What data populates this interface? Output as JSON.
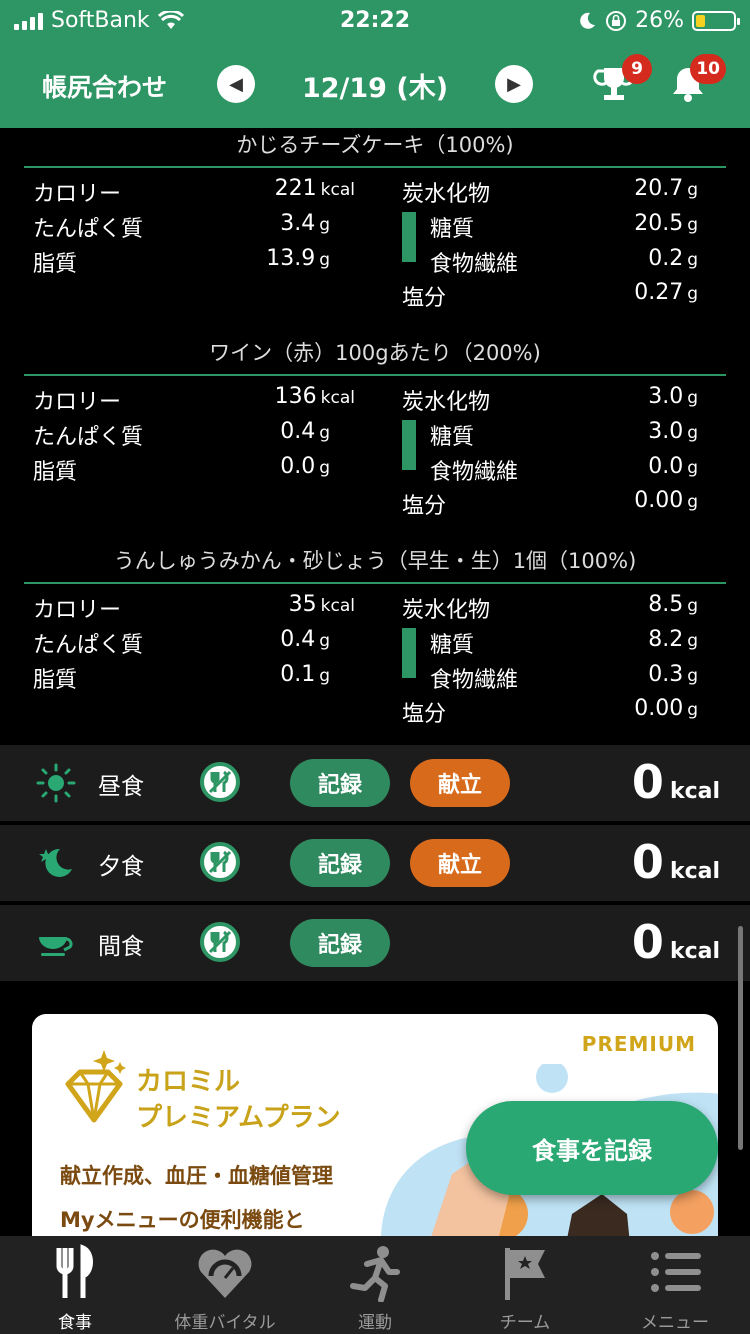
{
  "status_bar": {
    "carrier": "SoftBank",
    "time": "22:22",
    "battery": "26%",
    "battery_level": 0.26
  },
  "header": {
    "title": "帳尻合わせ",
    "date": "12/19 (木)",
    "trophy_badge": "9",
    "bell_badge": "10",
    "prev_icon": "chevron-left-icon",
    "next_icon": "chevron-right-icon"
  },
  "foods": [
    {
      "title": "かじるチーズケーキ（100%)",
      "calories_label": "カロリー",
      "calories": "221",
      "calories_unit": "kcal",
      "protein_label": "たんぱく質",
      "protein": "3.4",
      "protein_unit": "g",
      "fat_label": "脂質",
      "fat": "13.9",
      "fat_unit": "g",
      "carbs_label": "炭水化物",
      "carbs": "20.7",
      "carbs_unit": "g",
      "sugar_label": "糖質",
      "sugar": "20.5",
      "sugar_unit": "g",
      "fiber_label": "食物繊維",
      "fiber": "0.2",
      "fiber_unit": "g",
      "salt_label": "塩分",
      "salt": "0.27",
      "salt_unit": "g"
    },
    {
      "title": "ワイン（赤）100gあたり（200%)",
      "calories_label": "カロリー",
      "calories": "136",
      "calories_unit": "kcal",
      "protein_label": "たんぱく質",
      "protein": "0.4",
      "protein_unit": "g",
      "fat_label": "脂質",
      "fat": "0.0",
      "fat_unit": "g",
      "carbs_label": "炭水化物",
      "carbs": "3.0",
      "carbs_unit": "g",
      "sugar_label": "糖質",
      "sugar": "3.0",
      "sugar_unit": "g",
      "fiber_label": "食物繊維",
      "fiber": "0.0",
      "fiber_unit": "g",
      "salt_label": "塩分",
      "salt": "0.00",
      "salt_unit": "g"
    },
    {
      "title": "うんしゅうみかん・砂じょう（早生・生）1個（100%)",
      "calories_label": "カロリー",
      "calories": "35",
      "calories_unit": "kcal",
      "protein_label": "たんぱく質",
      "protein": "0.4",
      "protein_unit": "g",
      "fat_label": "脂質",
      "fat": "0.1",
      "fat_unit": "g",
      "carbs_label": "炭水化物",
      "carbs": "8.5",
      "carbs_unit": "g",
      "sugar_label": "糖質",
      "sugar": "8.2",
      "sugar_unit": "g",
      "fiber_label": "食物繊維",
      "fiber": "0.3",
      "fiber_unit": "g",
      "salt_label": "塩分",
      "salt": "0.00",
      "salt_unit": "g"
    }
  ],
  "meals": {
    "lunch": {
      "name": "昼食",
      "record": "記録",
      "menu": "献立",
      "kcal": "0",
      "unit": "kcal",
      "icon": "sun-icon"
    },
    "dinner": {
      "name": "夕食",
      "record": "記録",
      "menu": "献立",
      "kcal": "0",
      "unit": "kcal",
      "icon": "moon-star-icon"
    },
    "snack": {
      "name": "間食",
      "record": "記録",
      "kcal": "0",
      "unit": "kcal",
      "icon": "cup-icon"
    }
  },
  "premium": {
    "tag": "PREMIUM",
    "name_line1": "カロミル",
    "name_line2": "プレミアムプラン",
    "desc_line1": "献立作成、血圧・血糖値管理",
    "desc_line2": "Myメニューの便利機能と"
  },
  "fab": {
    "label": "食事を記録"
  },
  "tabs": [
    {
      "label": "食事",
      "icon": "fork-knife-icon",
      "active": true
    },
    {
      "label": "体重バイタル",
      "icon": "heart-scale-icon",
      "active": false
    },
    {
      "label": "運動",
      "icon": "runner-icon",
      "active": false
    },
    {
      "label": "チーム",
      "icon": "flag-icon",
      "active": false
    },
    {
      "label": "メニュー",
      "icon": "list-icon",
      "active": false
    }
  ],
  "colors": {
    "brand_green": "#2e9664",
    "orange": "#d76a1b",
    "badge_red": "#d42b1e",
    "premium_gold": "#d1a51a"
  }
}
